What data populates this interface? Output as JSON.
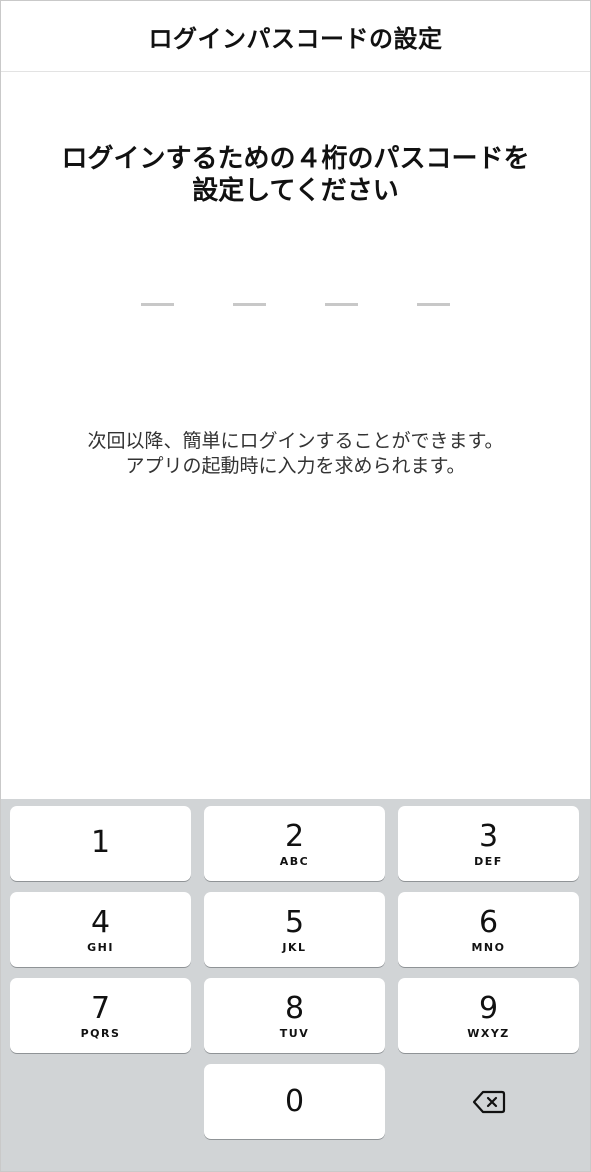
{
  "header": {
    "title": "ログインパスコードの設定"
  },
  "instruction": {
    "line1": "ログインするための４桁のパスコードを",
    "line2": "設定してください"
  },
  "pin": {
    "length": 4,
    "entered": 0
  },
  "note": {
    "line1": "次回以降、簡単にログインすることができます。",
    "line2": "アプリの起動時に入力を求められます。"
  },
  "keypad": {
    "keys": [
      {
        "digit": "1",
        "letters": ""
      },
      {
        "digit": "2",
        "letters": "ABC"
      },
      {
        "digit": "3",
        "letters": "DEF"
      },
      {
        "digit": "4",
        "letters": "GHI"
      },
      {
        "digit": "5",
        "letters": "JKL"
      },
      {
        "digit": "6",
        "letters": "MNO"
      },
      {
        "digit": "7",
        "letters": "PQRS"
      },
      {
        "digit": "8",
        "letters": "TUV"
      },
      {
        "digit": "9",
        "letters": "WXYZ"
      },
      {
        "digit": "0",
        "letters": ""
      }
    ],
    "delete_icon": "backspace-icon"
  },
  "colors": {
    "keypad_bg": "#d1d4d6",
    "key_bg": "#ffffff",
    "pin_dash": "#c8c8c8"
  }
}
